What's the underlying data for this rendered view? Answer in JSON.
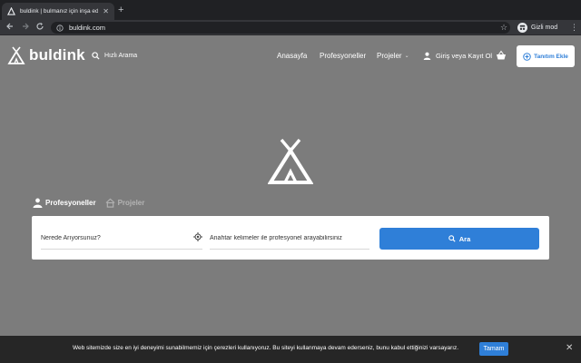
{
  "browser": {
    "tab_title": "buldink | bulmanız için inşa edi",
    "url": "buldink.com",
    "profile_label": "Gizli mod",
    "new_tab_glyph": "+",
    "close_tab_glyph": "✕"
  },
  "header": {
    "logo_text": "buldink",
    "quick_search": "Hızlı Arama",
    "nav": {
      "home": "Anasayfa",
      "professionals": "Profesyoneller",
      "projects": "Projeler"
    },
    "login": "Giriş veya Kayıt Ol",
    "add_listing": "Tanıtım Ekle"
  },
  "search": {
    "tabs": [
      {
        "label": "Profesyoneller",
        "active": true
      },
      {
        "label": "Projeler",
        "active": false
      }
    ],
    "location_placeholder": "Nerede Arıyorsunuz?",
    "keyword_placeholder": "Anahtar kelimeler ile profesyonel arayabilirsiniz",
    "button_label": "Ara"
  },
  "cookie": {
    "message": "Web sitemizde size en iyi deneyimi sunabilmemiz için çerezleri kullanıyoruz. Bu siteyi kullanmaya devam ederseniz, bunu kabul ettiğinizi varsayarız.",
    "accept_label": "Tamam"
  },
  "icons": {
    "back": "back-arrow-icon",
    "forward": "forward-arrow-icon",
    "reload": "reload-icon",
    "lock": "info-icon",
    "star": "bookmark-star-icon",
    "incognito": "incognito-icon",
    "menu": "kebab-menu-icon",
    "search": "search-icon",
    "user": "user-icon",
    "cart": "basket-icon",
    "plus_circle": "plus-circle-icon",
    "location": "location-target-icon"
  },
  "colors": {
    "accent": "#2f7fd8",
    "overlay": "#7c7c7c",
    "cookie_bar": "#262626"
  }
}
